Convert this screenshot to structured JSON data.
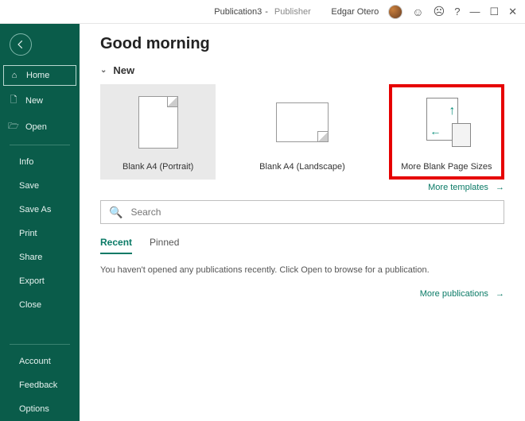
{
  "titlebar": {
    "doc_name": "Publication3",
    "separator": "-",
    "app_name": "Publisher",
    "user_name": "Edgar Otero"
  },
  "sidebar": {
    "home": "Home",
    "new": "New",
    "open": "Open",
    "info": "Info",
    "save": "Save",
    "save_as": "Save As",
    "print": "Print",
    "share": "Share",
    "export": "Export",
    "close": "Close",
    "account": "Account",
    "feedback": "Feedback",
    "options": "Options"
  },
  "main": {
    "greeting": "Good morning",
    "new_section": "New",
    "templates": {
      "a4_portrait": "Blank A4 (Portrait)",
      "a4_landscape": "Blank A4 (Landscape)",
      "more_sizes": "More Blank Page Sizes"
    },
    "more_templates": "More templates",
    "search_placeholder": "Search",
    "tabs": {
      "recent": "Recent",
      "pinned": "Pinned"
    },
    "empty_recent": "You haven't opened any publications recently. Click Open to browse for a publication.",
    "more_publications": "More publications"
  }
}
